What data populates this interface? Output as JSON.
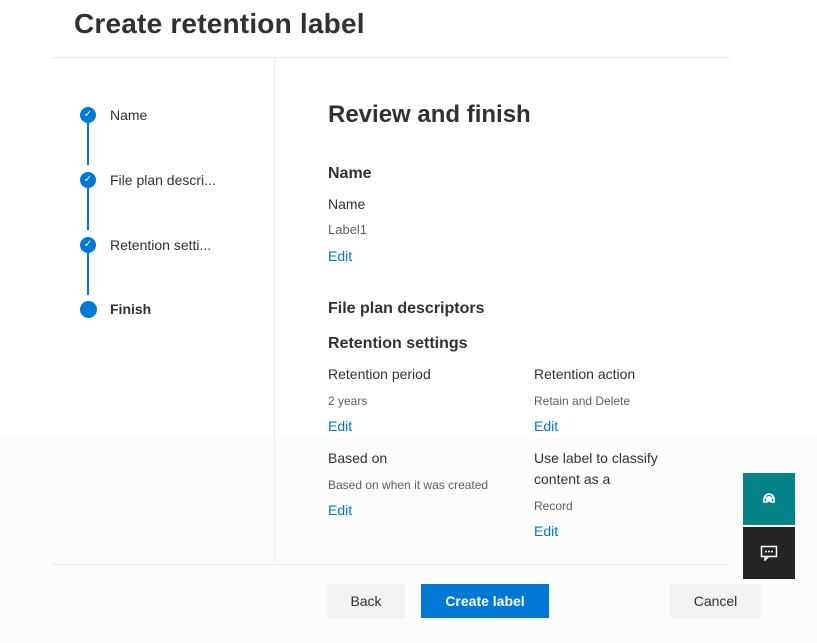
{
  "page": {
    "title": "Create retention label"
  },
  "steps": [
    {
      "label": "Name",
      "state": "done"
    },
    {
      "label": "File plan descri...",
      "state": "done"
    },
    {
      "label": "Retention setti...",
      "state": "done"
    },
    {
      "label": "Finish",
      "state": "current"
    }
  ],
  "review": {
    "title": "Review and finish",
    "name_section": {
      "heading": "Name",
      "field_label": "Name",
      "value": "Label1",
      "edit": "Edit"
    },
    "file_plan": {
      "heading": "File plan descriptors"
    },
    "retention": {
      "heading": "Retention settings",
      "period_label": "Retention period",
      "period_value": "2 years",
      "period_edit": "Edit",
      "action_label": "Retention action",
      "action_value": "Retain and Delete",
      "action_edit": "Edit",
      "based_label": "Based on",
      "based_value": "Based on when it was created",
      "based_edit": "Edit",
      "classify_label": "Use label to classify content as a",
      "classify_value": "Record",
      "classify_edit": "Edit"
    }
  },
  "footer": {
    "back": "Back",
    "create": "Create label",
    "cancel": "Cancel"
  },
  "floating": {
    "help_icon": "headset-icon",
    "feedback_icon": "chat-icon"
  },
  "colors": {
    "accent": "#0078d4",
    "teal": "#038387",
    "dark": "#252423"
  }
}
